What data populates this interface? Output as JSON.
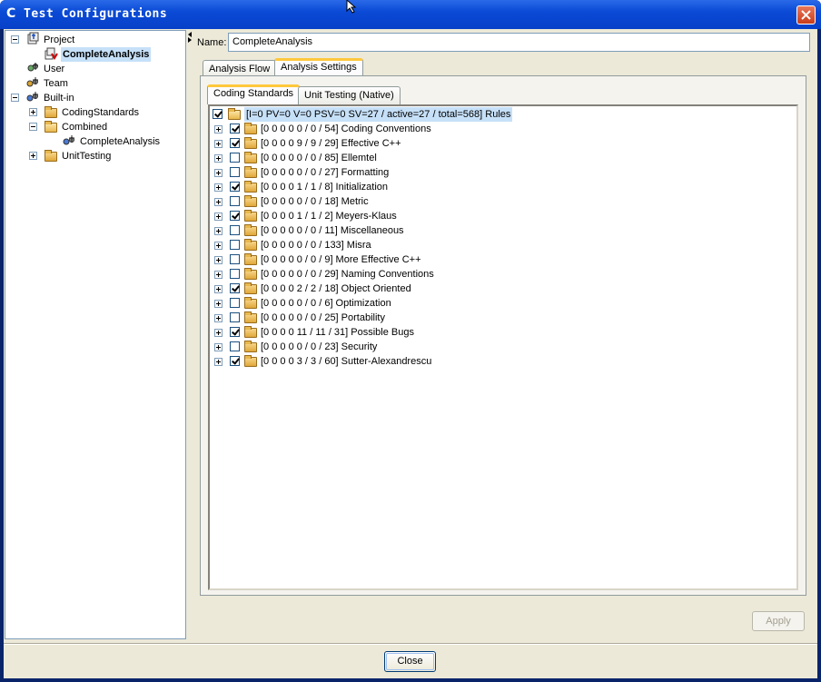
{
  "window": {
    "title": "Test Configurations",
    "app_icon": "C"
  },
  "tree": {
    "project": "Project",
    "project_child": "CompleteAnalysis",
    "user": "User",
    "team": "Team",
    "builtin": "Built-in",
    "coding_standards": "CodingStandards",
    "combined": "Combined",
    "combined_child": "CompleteAnalysis",
    "unit_testing": "UnitTesting"
  },
  "form": {
    "name_label": "Name:",
    "name_value": "CompleteAnalysis"
  },
  "tabs": {
    "analysis_flow": "Analysis Flow",
    "analysis_settings": "Analysis Settings",
    "coding_standards": "Coding Standards",
    "unit_testing": "Unit Testing (Native)"
  },
  "rules": {
    "root": "[I=0 PV=0 V=0 PSV=0 SV=27 / active=27 / total=568] Rules",
    "items": [
      {
        "label": "[0 0 0 0 0 / 0 / 54] Coding Conventions",
        "checked": true
      },
      {
        "label": "[0 0 0 0 9 / 9 / 29] Effective C++",
        "checked": true
      },
      {
        "label": "[0 0 0 0 0 / 0 / 85] Ellemtel",
        "checked": false
      },
      {
        "label": "[0 0 0 0 0 / 0 / 27] Formatting",
        "checked": false
      },
      {
        "label": "[0 0 0 0 1 / 1 / 8] Initialization",
        "checked": true
      },
      {
        "label": "[0 0 0 0 0 / 0 / 18] Metric",
        "checked": false
      },
      {
        "label": "[0 0 0 0 1 / 1 / 2] Meyers-Klaus",
        "checked": true
      },
      {
        "label": "[0 0 0 0 0 / 0 / 11] Miscellaneous",
        "checked": false
      },
      {
        "label": "[0 0 0 0 0 / 0 / 133] Misra",
        "checked": false
      },
      {
        "label": "[0 0 0 0 0 / 0 / 9] More Effective C++",
        "checked": false
      },
      {
        "label": "[0 0 0 0 0 / 0 / 29] Naming Conventions",
        "checked": false
      },
      {
        "label": "[0 0 0 0 2 / 2 / 18] Object Oriented",
        "checked": true
      },
      {
        "label": "[0 0 0 0 0 / 0 / 6] Optimization",
        "checked": false
      },
      {
        "label": "[0 0 0 0 0 / 0 / 25] Portability",
        "checked": false
      },
      {
        "label": "[0 0 0 0 11 / 11 / 31] Possible Bugs",
        "checked": true
      },
      {
        "label": "[0 0 0 0 0 / 0 / 23] Security",
        "checked": false
      },
      {
        "label": "[0 0 0 0 3 / 3 / 60] Sutter-Alexandrescu",
        "checked": true
      }
    ]
  },
  "buttons": {
    "apply": "Apply",
    "close": "Close"
  },
  "icons": {
    "window_close": "close-icon",
    "folder": "folder-icon",
    "config": "config-icon"
  }
}
